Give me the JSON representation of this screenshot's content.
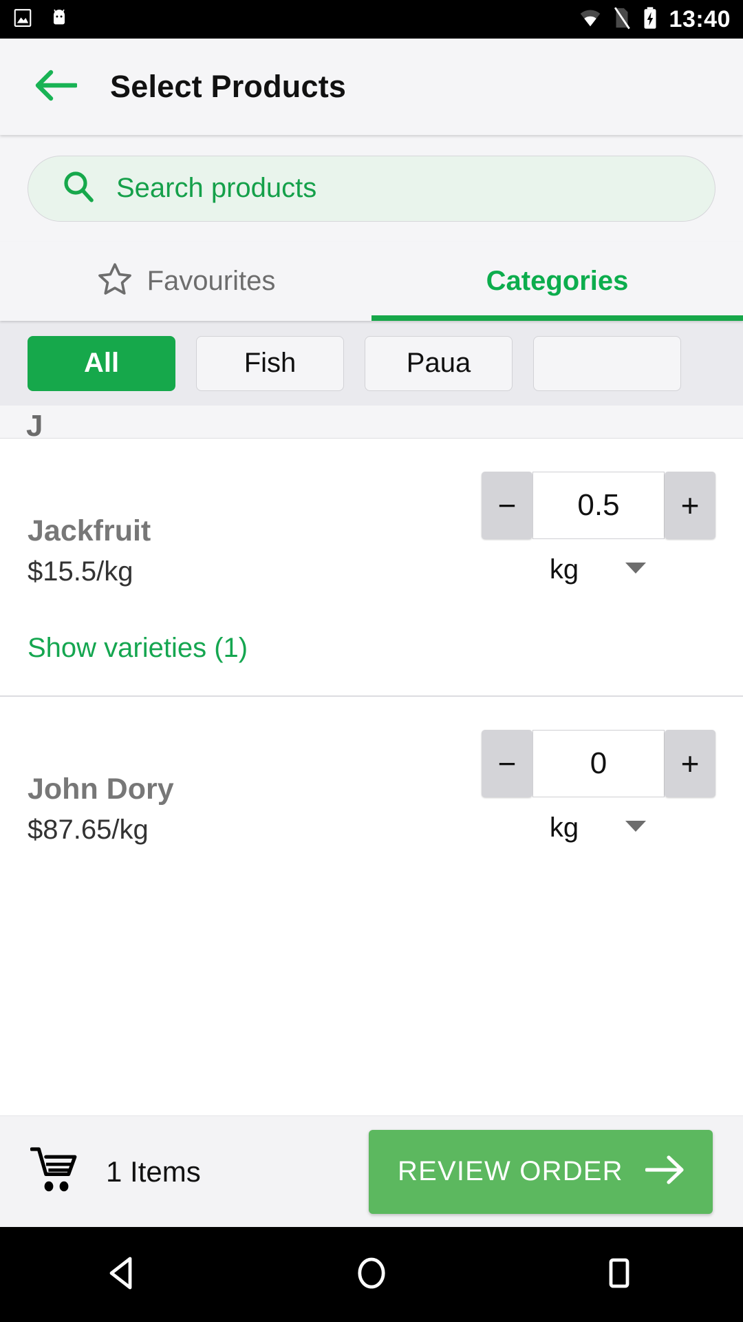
{
  "status_bar": {
    "time": "13:40",
    "icons": [
      "image-icon",
      "android-robot-icon",
      "wifi-icon",
      "sim-off-icon",
      "battery-charging-icon"
    ]
  },
  "app_bar": {
    "title": "Select Products",
    "back_icon": "back-arrow-icon"
  },
  "search": {
    "placeholder": "Search products",
    "value": "",
    "icon": "search-icon"
  },
  "tabs": [
    {
      "label": "Favourites",
      "icon": "star-outline-icon",
      "active": false
    },
    {
      "label": "Categories",
      "icon": "",
      "active": true
    }
  ],
  "categories": [
    {
      "label": "All",
      "selected": true
    },
    {
      "label": "Fish",
      "selected": false
    },
    {
      "label": "Paua",
      "selected": false
    },
    {
      "label": "",
      "selected": false
    }
  ],
  "section_header": "J",
  "products": [
    {
      "name": "Jackfruit",
      "price": "$15.5/kg",
      "quantity": "0.5",
      "unit": "kg",
      "decrement_label": "−",
      "increment_label": "+",
      "varieties_label": "Show varieties (1)"
    },
    {
      "name": "John Dory",
      "price": "$87.65/kg",
      "quantity": "0",
      "unit": "kg",
      "decrement_label": "−",
      "increment_label": "+",
      "varieties_label": ""
    }
  ],
  "action_bar": {
    "cart_icon": "shopping-cart-icon",
    "cart_count_label": "1 Items",
    "review_label": "REVIEW ORDER",
    "review_arrow_icon": "arrow-right-icon"
  },
  "nav_bar": {
    "back": "back-triangle-icon",
    "home": "home-circle-icon",
    "recents": "recents-square-icon"
  },
  "colors": {
    "accent_green": "#16a84b",
    "tab_green": "#0cad4d",
    "button_green": "#5cb85f",
    "search_bg": "#e9f4ec"
  }
}
